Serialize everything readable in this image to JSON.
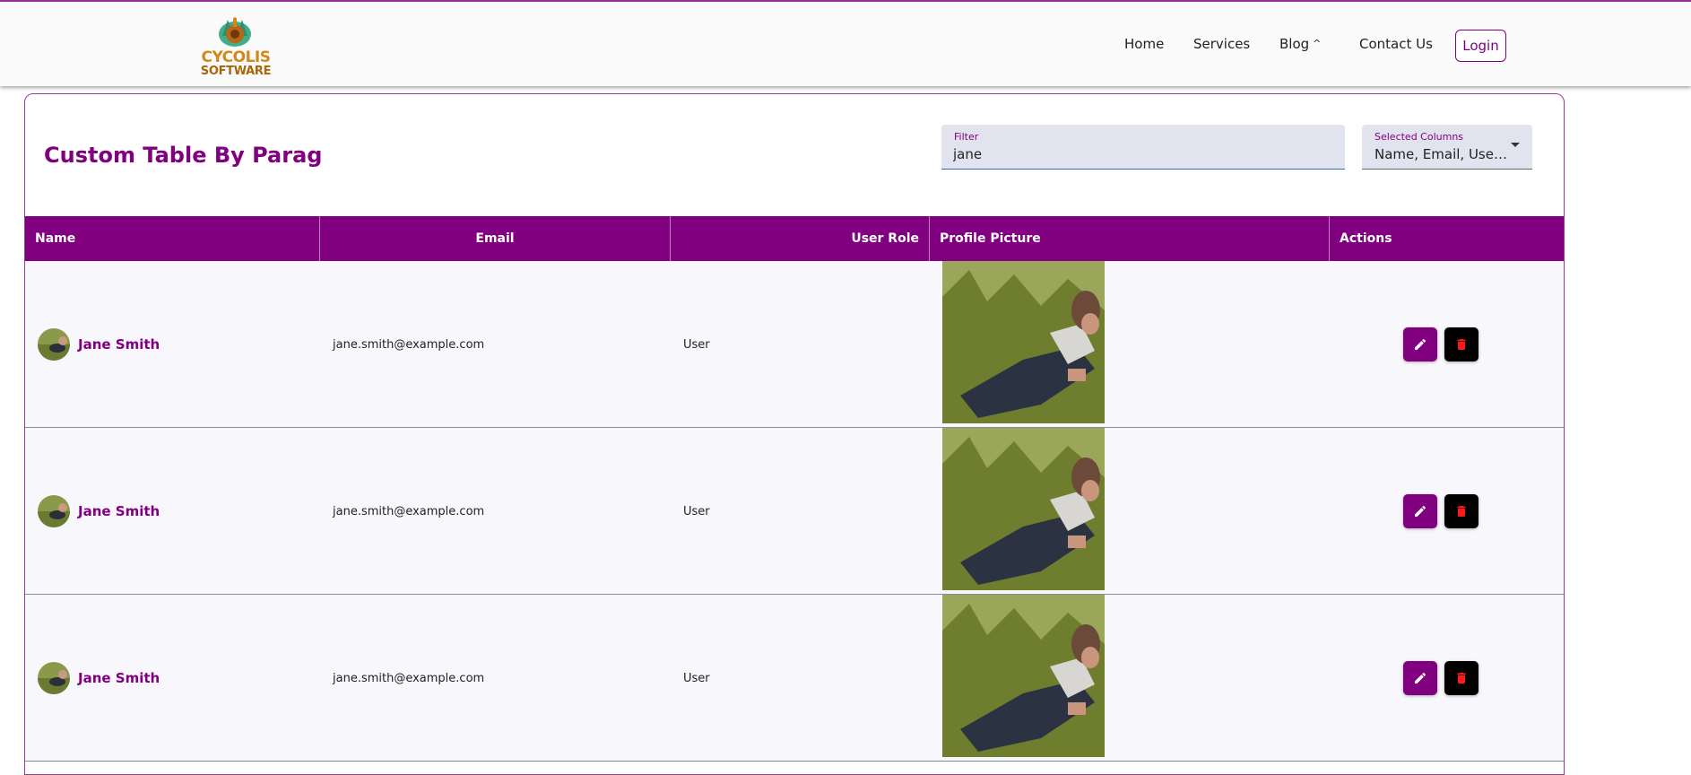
{
  "brand": {
    "line1": "CYCOLIS",
    "line2": "SOFTWARE",
    "primary_color": "#800080",
    "logo_orange": "#d4881a"
  },
  "nav": {
    "home": "Home",
    "services": "Services",
    "blog": "Blog",
    "contact": "Contact Us",
    "login": "Login"
  },
  "page": {
    "title": "Custom Table By Parag"
  },
  "filter": {
    "label": "Filter",
    "value": "jane"
  },
  "column_select": {
    "label": "Selected Columns",
    "value": "Name, Email, User Role, Profile Picture, Actions"
  },
  "table": {
    "headers": {
      "name": "Name",
      "email": "Email",
      "role": "User Role",
      "picture": "Profile Picture",
      "actions": "Actions"
    },
    "rows": [
      {
        "name": "Jane Smith",
        "email": "jane.smith@example.com",
        "role": "User"
      },
      {
        "name": "Jane Smith",
        "email": "jane.smith@example.com",
        "role": "User"
      },
      {
        "name": "Jane Smith",
        "email": "jane.smith@example.com",
        "role": "User"
      }
    ]
  },
  "icons": {
    "edit": "edit-icon",
    "delete": "delete-icon",
    "dropdown": "chevron-down-icon",
    "blog_caret": "chevron-up-icon"
  },
  "colors": {
    "header_bg": "#800080",
    "delete_icon": "#ff1a1a",
    "row_bg": "#f7f7fc",
    "field_bg": "#e1e3ee"
  }
}
